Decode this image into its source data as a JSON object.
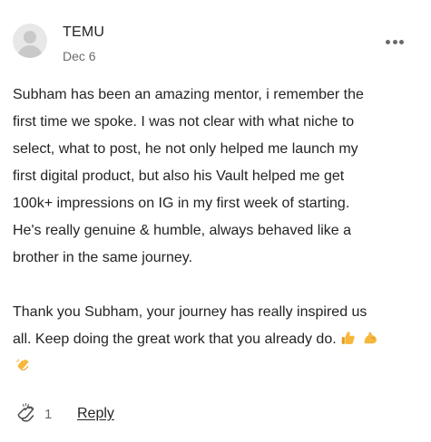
{
  "comment": {
    "author": "TEMU",
    "date": "Dec 6",
    "body_lines": [
      "Subham has been an amazing mentor, i remember the",
      "first time we spoke. I was not clear with what niche to",
      "select, what to post, he not only helped me launch my",
      "first digital product, but also his Vault helped me get",
      "100k+ impressions on IG in my first week of starting.",
      "He's really genuine & humble, always behaved like a",
      "brother in the same journey."
    ],
    "closing_lines": [
      "Thank you Subham, your journey has really inspired us",
      "all. Keep doing the great work that you already do."
    ],
    "emojis": [
      "thumbs-up-emoji",
      "flexed-biceps-emoji",
      "clapping-hands-emoji"
    ],
    "clap_count": "1",
    "reply_label": "Reply"
  },
  "icons": {
    "avatar": "avatar-placeholder-icon",
    "more": "more-options-icon",
    "clap": "clap-icon"
  },
  "colors": {
    "text": "#242424",
    "muted": "#6b6b6b",
    "avatar_bg": "#e8e8e8",
    "emoji_yellow": "#f6b73c"
  }
}
